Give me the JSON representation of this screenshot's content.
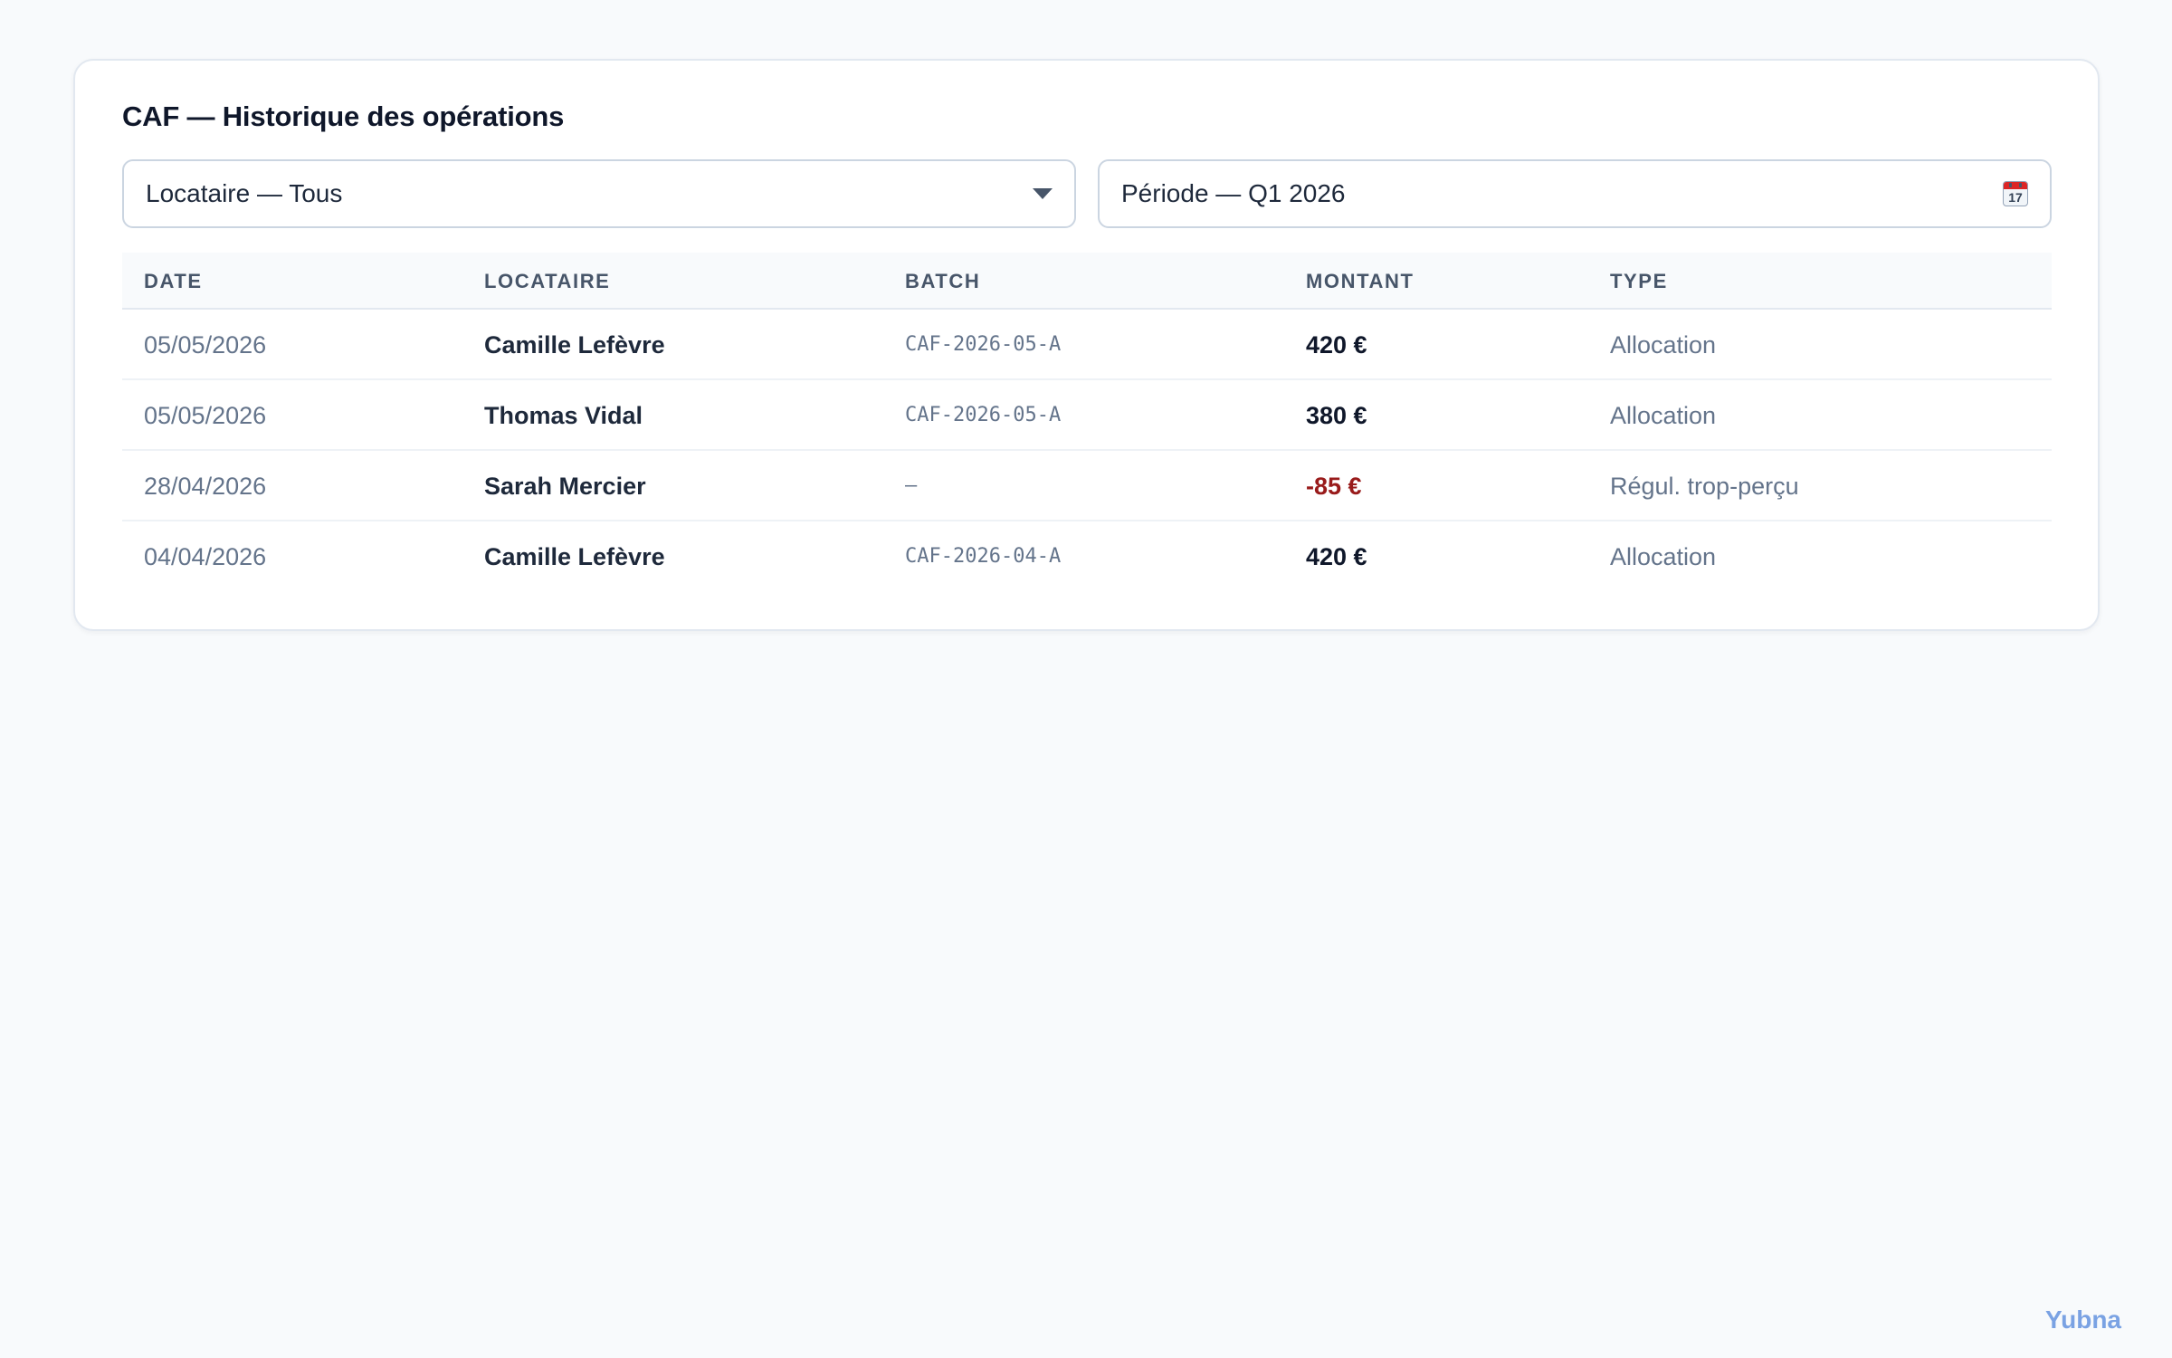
{
  "card": {
    "title": "CAF — Historique des opérations"
  },
  "filters": {
    "tenant": {
      "value": "Locataire — Tous",
      "icon": "chevron-down-icon"
    },
    "period": {
      "value": "Période — Q1 2026",
      "icon": "calendar-icon",
      "calendar_day": "17"
    }
  },
  "table": {
    "headers": {
      "date": "DATE",
      "tenant": "LOCATAIRE",
      "batch": "BATCH",
      "amount": "MONTANT",
      "type": "TYPE"
    },
    "rows": [
      {
        "date": "05/05/2026",
        "tenant": "Camille Lefèvre",
        "batch": "CAF-2026-05-A",
        "amount": "420 €",
        "type": "Allocation",
        "negative": false
      },
      {
        "date": "05/05/2026",
        "tenant": "Thomas Vidal",
        "batch": "CAF-2026-05-A",
        "amount": "380 €",
        "type": "Allocation",
        "negative": false
      },
      {
        "date": "28/04/2026",
        "tenant": "Sarah Mercier",
        "batch": "—",
        "amount": "-85 €",
        "type": "Régul. trop-perçu",
        "negative": true
      },
      {
        "date": "04/04/2026",
        "tenant": "Camille Lefèvre",
        "batch": "CAF-2026-04-A",
        "amount": "420 €",
        "type": "Allocation",
        "negative": false
      }
    ]
  },
  "colors": {
    "negative_amount": "#991b1b",
    "brand": "#7aa2e3"
  },
  "brand": {
    "name": "Yubna"
  }
}
